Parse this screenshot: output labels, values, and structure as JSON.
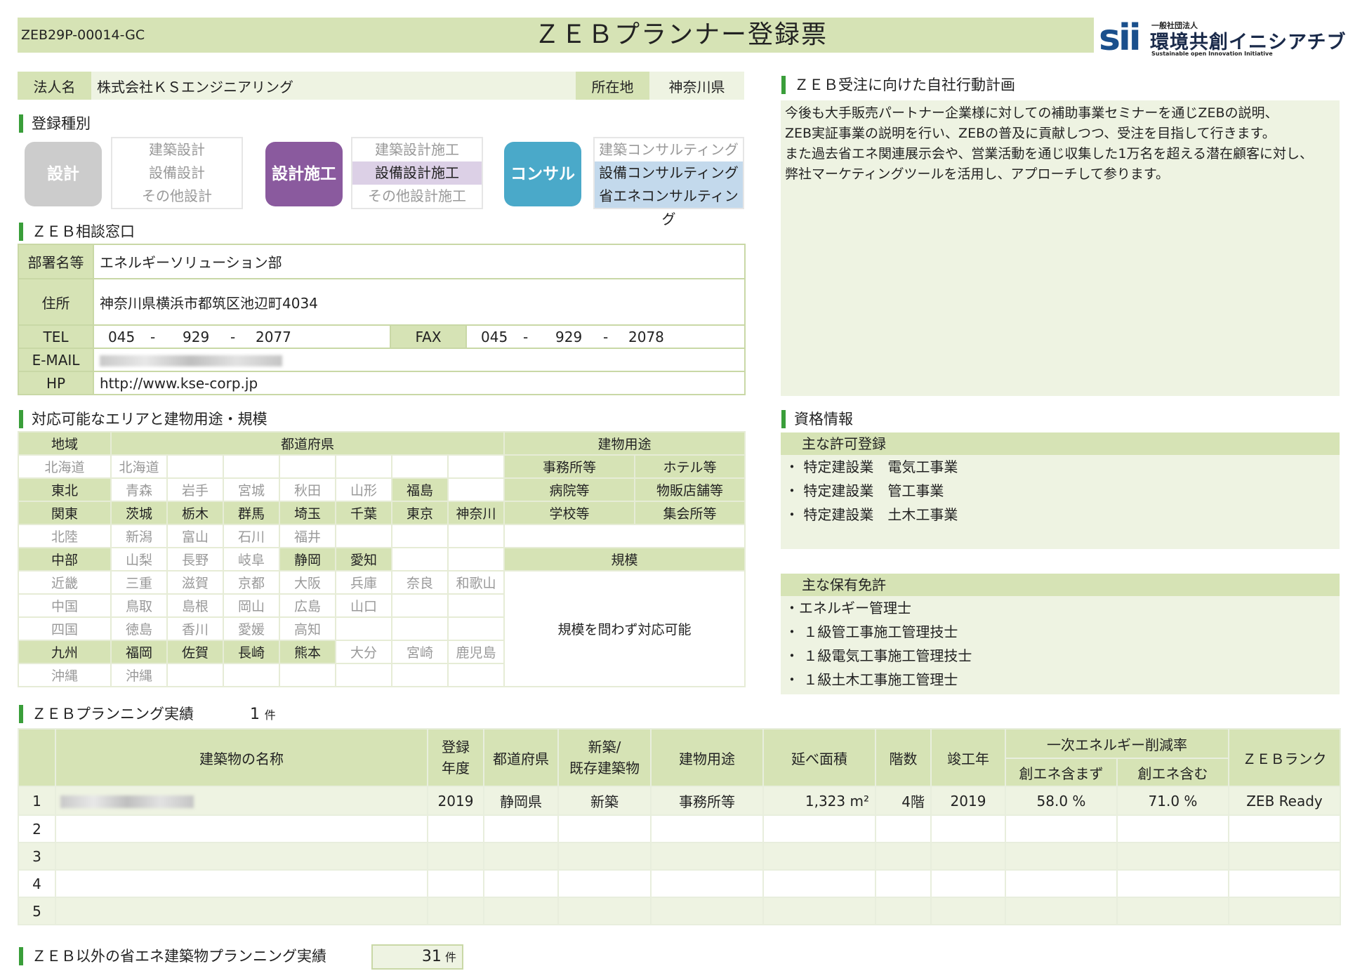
{
  "header": {
    "code": "ZEB29P-00014-GC",
    "title": "ＺＥＢプランナー登録票",
    "logo": {
      "mark": "sii",
      "org_small": "一般社団法人",
      "org_name": "環境共創イニシアチブ",
      "org_en": "Sustainable open Innovation Initiative"
    }
  },
  "corp": {
    "name_label": "法人名",
    "name": "株式会社ＫＳエンジニアリング",
    "loc_label": "所在地",
    "loc": "神奈川県"
  },
  "registration": {
    "title": "登録種別",
    "groups": [
      {
        "pill": "設計",
        "pill_color": "#cccccc",
        "items": [
          {
            "label": "建築設計",
            "active": false
          },
          {
            "label": "設備設計",
            "active": false
          },
          {
            "label": "その他設計",
            "active": false
          }
        ]
      },
      {
        "pill": "設計施工",
        "pill_color": "#8a5a9e",
        "items": [
          {
            "label": "建築設計施工",
            "active": false
          },
          {
            "label": "設備設計施工",
            "active": true
          },
          {
            "label": "その他設計施工",
            "active": false
          }
        ]
      },
      {
        "pill": "コンサル",
        "pill_color": "#4aa9c9",
        "items": [
          {
            "label": "建築コンサルティング",
            "active": false
          },
          {
            "label": "設備コンサルティング",
            "active": true
          },
          {
            "label": "省エネコンサルティング",
            "active": true
          }
        ]
      }
    ],
    "active_colors": [
      "#dcd0e6",
      "#c3d9ec"
    ]
  },
  "window": {
    "title": "ＺＥＢ相談窓口",
    "dept_label": "部署名等",
    "dept": "エネルギーソリューション部",
    "addr_label": "住所",
    "addr": "神奈川県横浜市都筑区池辺町4034",
    "tel_label": "TEL",
    "tel": [
      "045",
      "929",
      "2077"
    ],
    "fax_label": "FAX",
    "fax": [
      "045",
      "929",
      "2078"
    ],
    "sep": "-",
    "mail_label": "E-MAIL",
    "hp_label": "HP",
    "hp": "http://www.kse-corp.jp"
  },
  "area": {
    "title": "対応可能なエリアと建物用途・規模",
    "region_head": "地域",
    "pref_head": "都道府県",
    "use_head": "建物用途",
    "scale_head": "規模",
    "scale_text": "規模を問わず対応可能",
    "rows": [
      {
        "region": "北海道",
        "on": false,
        "prefs": [
          {
            "n": "北海道",
            "on": false
          }
        ]
      },
      {
        "region": "東北",
        "on": true,
        "prefs": [
          {
            "n": "青森",
            "on": false
          },
          {
            "n": "岩手",
            "on": false
          },
          {
            "n": "宮城",
            "on": false
          },
          {
            "n": "秋田",
            "on": false
          },
          {
            "n": "山形",
            "on": false
          },
          {
            "n": "福島",
            "on": true
          }
        ]
      },
      {
        "region": "関東",
        "on": true,
        "prefs": [
          {
            "n": "茨城",
            "on": true
          },
          {
            "n": "栃木",
            "on": true
          },
          {
            "n": "群馬",
            "on": true
          },
          {
            "n": "埼玉",
            "on": true
          },
          {
            "n": "千葉",
            "on": true
          },
          {
            "n": "東京",
            "on": true
          },
          {
            "n": "神奈川",
            "on": true
          }
        ]
      },
      {
        "region": "北陸",
        "on": false,
        "prefs": [
          {
            "n": "新潟",
            "on": false
          },
          {
            "n": "富山",
            "on": false
          },
          {
            "n": "石川",
            "on": false
          },
          {
            "n": "福井",
            "on": false
          }
        ]
      },
      {
        "region": "中部",
        "on": true,
        "prefs": [
          {
            "n": "山梨",
            "on": false
          },
          {
            "n": "長野",
            "on": false
          },
          {
            "n": "岐阜",
            "on": false
          },
          {
            "n": "静岡",
            "on": true
          },
          {
            "n": "愛知",
            "on": true
          }
        ]
      },
      {
        "region": "近畿",
        "on": false,
        "prefs": [
          {
            "n": "三重",
            "on": false
          },
          {
            "n": "滋賀",
            "on": false
          },
          {
            "n": "京都",
            "on": false
          },
          {
            "n": "大阪",
            "on": false
          },
          {
            "n": "兵庫",
            "on": false
          },
          {
            "n": "奈良",
            "on": false
          },
          {
            "n": "和歌山",
            "on": false
          }
        ]
      },
      {
        "region": "中国",
        "on": false,
        "prefs": [
          {
            "n": "鳥取",
            "on": false
          },
          {
            "n": "島根",
            "on": false
          },
          {
            "n": "岡山",
            "on": false
          },
          {
            "n": "広島",
            "on": false
          },
          {
            "n": "山口",
            "on": false
          }
        ]
      },
      {
        "region": "四国",
        "on": false,
        "prefs": [
          {
            "n": "徳島",
            "on": false
          },
          {
            "n": "香川",
            "on": false
          },
          {
            "n": "愛媛",
            "on": false
          },
          {
            "n": "高知",
            "on": false
          }
        ]
      },
      {
        "region": "九州",
        "on": true,
        "prefs": [
          {
            "n": "福岡",
            "on": true
          },
          {
            "n": "佐賀",
            "on": true
          },
          {
            "n": "長崎",
            "on": true
          },
          {
            "n": "熊本",
            "on": true
          },
          {
            "n": "大分",
            "on": false
          },
          {
            "n": "宮崎",
            "on": false
          },
          {
            "n": "鹿児島",
            "on": false
          }
        ]
      },
      {
        "region": "沖縄",
        "on": false,
        "prefs": [
          {
            "n": "沖縄",
            "on": false
          }
        ]
      }
    ],
    "uses": [
      [
        "事務所等",
        "ホテル等"
      ],
      [
        "病院等",
        "物販店舗等"
      ],
      [
        "学校等",
        "集会所等"
      ]
    ]
  },
  "plan": {
    "title": "ＺＥＢ受注に向けた自社行動計画",
    "lines": [
      "今後も大手販売パートナー企業様に対しての補助事業セミナーを通じZEBの説明、",
      "ZEB実証事業の説明を行い、ZEBの普及に貢献しつつ、受注を目指して行きます。",
      "また過去省エネ関連展示会や、営業活動を通じ収集した1万名を超える潜在顧客に対し、",
      "弊社マーケティングツールを活用し、アプローチして参ります。"
    ]
  },
  "qual": {
    "title": "資格情報",
    "permits_head": "主な許可登録",
    "permits": [
      "・ 特定建設業　電気工事業",
      "・ 特定建設業　管工事業",
      "・ 特定建設業　土木工事業"
    ],
    "licenses_head": "主な保有免許",
    "licenses": [
      "・エネルギー管理士",
      "・ １級管工事施工管理技士",
      "・ １級電気工事施工管理技士",
      "・ １級土木工事施工管理士"
    ]
  },
  "record": {
    "title": "ＺＥＢプランニング実績",
    "count": "1",
    "unit": "件",
    "headers": {
      "name": "建築物の名称",
      "year": "登録\n年度",
      "pref": "都道府県",
      "new": "新築/\n既存建築物",
      "use": "建物用途",
      "area": "延べ面積",
      "floors": "階数",
      "done": "竣工年",
      "reduction": "一次エネルギー削減率",
      "without": "創エネ含まず",
      "with": "創エネ含む",
      "rank": "ＺＥＢランク"
    },
    "rows": [
      {
        "no": "1",
        "year": "2019",
        "pref": "静岡県",
        "new": "新築",
        "use": "事務所等",
        "area": "1,323 m²",
        "floors": "4階",
        "done": "2019",
        "without": "58.0 %",
        "with": "71.0 %",
        "rank": "ZEB Ready"
      },
      {
        "no": "2"
      },
      {
        "no": "3"
      },
      {
        "no": "4"
      },
      {
        "no": "5"
      }
    ]
  },
  "other": {
    "title": "ＺＥＢ以外の省エネ建築物プランニング実績",
    "count": "31",
    "unit": "件"
  }
}
